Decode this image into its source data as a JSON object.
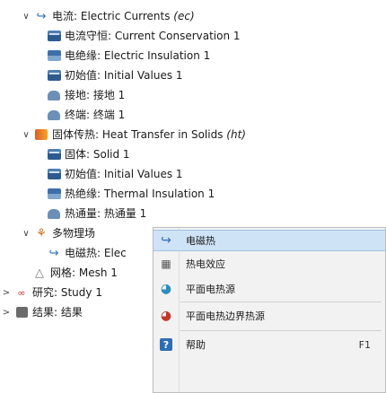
{
  "tree": {
    "ec": {
      "label": "电流: Electric Currents ",
      "tag": "(ec)"
    },
    "ec_children": [
      {
        "label": "电流守恒: Current Conservation 1",
        "icon": "db"
      },
      {
        "label": "电绝缘: Electric Insulation 1",
        "icon": "bc"
      },
      {
        "label": "初始值: Initial Values 1",
        "icon": "db"
      },
      {
        "label": "接地: 接地 1",
        "icon": "ref"
      },
      {
        "label": "终端: 终端 1",
        "icon": "ref"
      }
    ],
    "ht": {
      "label": "固体传热: Heat Transfer in Solids ",
      "tag": "(ht)"
    },
    "ht_children": [
      {
        "label": "固体: Solid 1",
        "icon": "db"
      },
      {
        "label": "初始值: Initial Values 1",
        "icon": "db"
      },
      {
        "label": "热绝缘: Thermal Insulation 1",
        "icon": "bc"
      },
      {
        "label": "热通量: 热通量 1",
        "icon": "ref"
      }
    ],
    "mp": {
      "label": "多物理场"
    },
    "mp_child": {
      "label": "电磁热: Elec"
    },
    "mesh": {
      "label": "网格: Mesh 1"
    },
    "study": {
      "label": "研究: Study 1"
    },
    "results": {
      "label": "结果: 结果"
    }
  },
  "menu": {
    "items": [
      {
        "label": "电磁热",
        "key": ""
      },
      {
        "label": "热电效应",
        "key": ""
      },
      {
        "label": "平面电热源",
        "key": ""
      },
      {
        "label": "平面电热边界热源",
        "key": ""
      },
      {
        "label": "帮助",
        "key": "F1"
      }
    ]
  }
}
